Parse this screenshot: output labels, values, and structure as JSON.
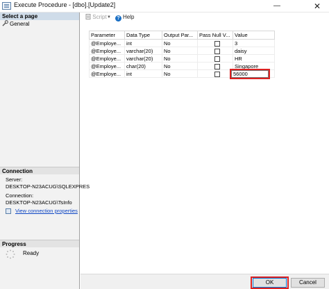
{
  "window": {
    "title": "Execute Procedure - [dbo].[Update2]",
    "minimize_glyph": "—",
    "close_glyph": "✕"
  },
  "left": {
    "select_page_header": "Select a page",
    "pages": [
      {
        "label": "General",
        "icon": "wrench-icon"
      }
    ],
    "connection_header": "Connection",
    "server_label": "Server:",
    "server_value": "DESKTOP-N23ACUG\\SQLEXPRES",
    "connection_label": "Connection:",
    "connection_value": "DESKTOP-N23ACUG\\TsInfo",
    "view_connection_link": "View connection properties",
    "progress_header": "Progress",
    "progress_status": "Ready"
  },
  "toolbar": {
    "script_label": "Script",
    "help_label": "Help"
  },
  "grid": {
    "columns": [
      "Parameter",
      "Data Type",
      "Output Par...",
      "Pass Null V...",
      "Value"
    ],
    "rows": [
      {
        "parameter": "@Employe...",
        "data_type": "int",
        "output": "No",
        "pass_null": false,
        "value": "3"
      },
      {
        "parameter": "@Employe...",
        "data_type": "varchar(20)",
        "output": "No",
        "pass_null": false,
        "value": "daisy"
      },
      {
        "parameter": "@Employe...",
        "data_type": "varchar(20)",
        "output": "No",
        "pass_null": false,
        "value": "HR"
      },
      {
        "parameter": "@Employe...",
        "data_type": "char(20)",
        "output": "No",
        "pass_null": false,
        "value": "Singapore"
      },
      {
        "parameter": "@Employe...",
        "data_type": "int",
        "output": "No",
        "pass_null": false,
        "value": "56000"
      }
    ]
  },
  "buttons": {
    "ok": "OK",
    "cancel": "Cancel"
  },
  "colors": {
    "highlight_red": "#dd2222",
    "link_blue": "#0b44c4",
    "header_blue": "#cfdce9"
  }
}
